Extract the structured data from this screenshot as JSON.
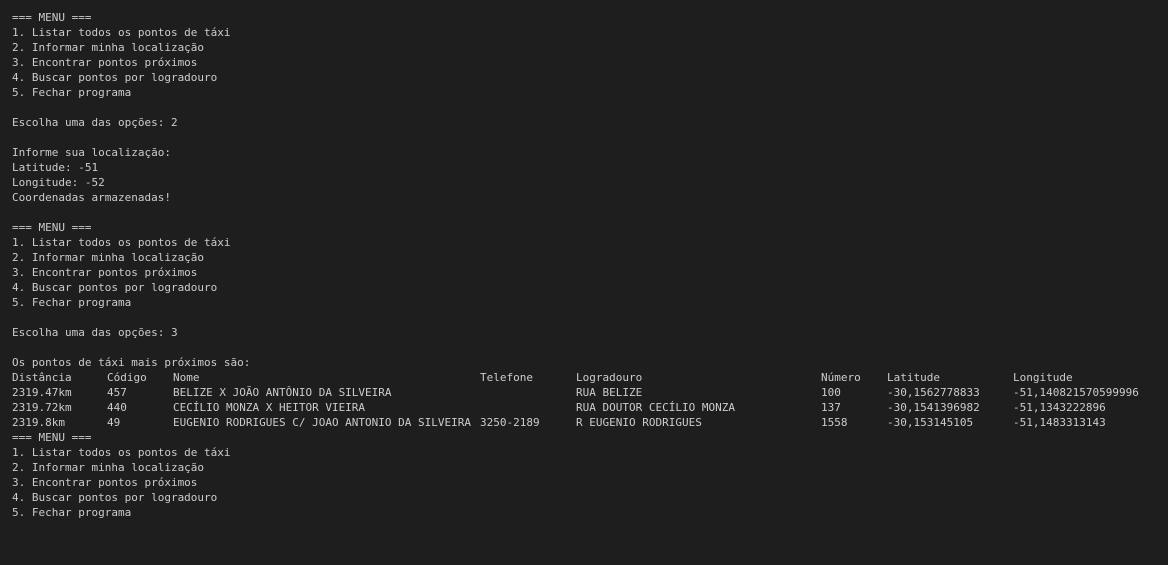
{
  "menu": {
    "header": "=== MENU ===",
    "items": [
      "1. Listar todos os pontos de táxi",
      "2. Informar minha localização",
      "3. Encontrar pontos próximos",
      "4. Buscar pontos por logradouro",
      "5. Fechar programa"
    ]
  },
  "session1": {
    "prompt": "Escolha uma das opções: 2",
    "location_prompt": "Informe sua localização:",
    "latitude": "Latitude: -51",
    "longitude": "Longitude: -52",
    "confirmation": "Coordenadas armazenadas!"
  },
  "session2": {
    "prompt": "Escolha uma das opções: 3",
    "results_title": "Os pontos de táxi mais próximos são:"
  },
  "table": {
    "headers": [
      "Distância",
      "Código",
      "Nome",
      "Telefone",
      "Logradouro",
      "Número",
      "Latitude",
      "Longitude"
    ],
    "rows": [
      [
        "2319.47km",
        "457",
        "BELIZE X JOÃO ANTÔNIO DA SILVEIRA",
        "",
        "RUA BELIZE",
        "100",
        "-30,1562778833",
        "-51,140821570599996"
      ],
      [
        "2319.72km",
        "440",
        "CECÍLIO MONZA X HEITOR VIEIRA",
        "",
        "RUA DOUTOR CECÍLIO MONZA",
        "137",
        "-30,1541396982",
        "-51,1343222896"
      ],
      [
        "2319.8km",
        "49",
        "EUGENIO RODRIGUES C/ JOAO ANTONIO DA SILVEIRA",
        "3250-2189",
        "R EUGENIO RODRIGUES",
        "1558",
        "-30,153145105",
        "-51,1483313143"
      ]
    ]
  }
}
